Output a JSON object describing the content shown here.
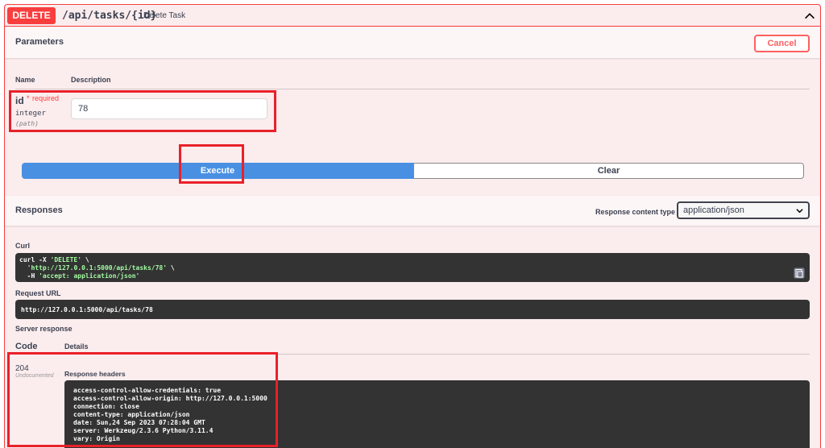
{
  "operation": {
    "method": "DELETE",
    "path": "/api/tasks/{id}",
    "summary": "Delete Task"
  },
  "parameters": {
    "title": "Parameters",
    "cancel_label": "Cancel",
    "col_name": "Name",
    "col_description": "Description",
    "items": [
      {
        "name": "id",
        "required_star": "*",
        "required_text": "required",
        "type": "integer",
        "in": "(path)",
        "value": "78"
      }
    ]
  },
  "actions": {
    "execute_label": "Execute",
    "clear_label": "Clear"
  },
  "responses": {
    "title": "Responses",
    "content_type_label": "Response content type",
    "content_type_value": "application/json",
    "curl_label": "Curl",
    "curl_lines": [
      [
        "curl -X ",
        "'DELETE'",
        " \\"
      ],
      [
        "  ",
        "'http://127.0.0.1:5000/api/tasks/78'",
        " \\"
      ],
      [
        "  -H ",
        "'accept: application/json'",
        ""
      ]
    ],
    "request_url_label": "Request URL",
    "request_url": "http://127.0.0.1:5000/api/tasks/78",
    "server_response_label": "Server response",
    "col_code": "Code",
    "col_details": "Details",
    "code": "204",
    "code_note": "Undocumented",
    "headers_label": "Response headers",
    "headers": [
      "access-control-allow-credentials: true",
      "access-control-allow-origin: http://127.0.0.1:5000",
      "connection: close",
      "content-type: application/json",
      "date: Sun,24 Sep 2023 07:28:04 GMT",
      "server: Werkzeug/2.3.6 Python/3.11.4",
      "vary: Origin"
    ]
  },
  "icons": {
    "collapse": "chevron-up-icon",
    "select": "chevron-down-icon",
    "copy": "copy-icon"
  },
  "colors": {
    "delete": "#f93e3e",
    "execute": "#4990e2",
    "highlight": "#e8212a",
    "code_bg": "#333333"
  }
}
